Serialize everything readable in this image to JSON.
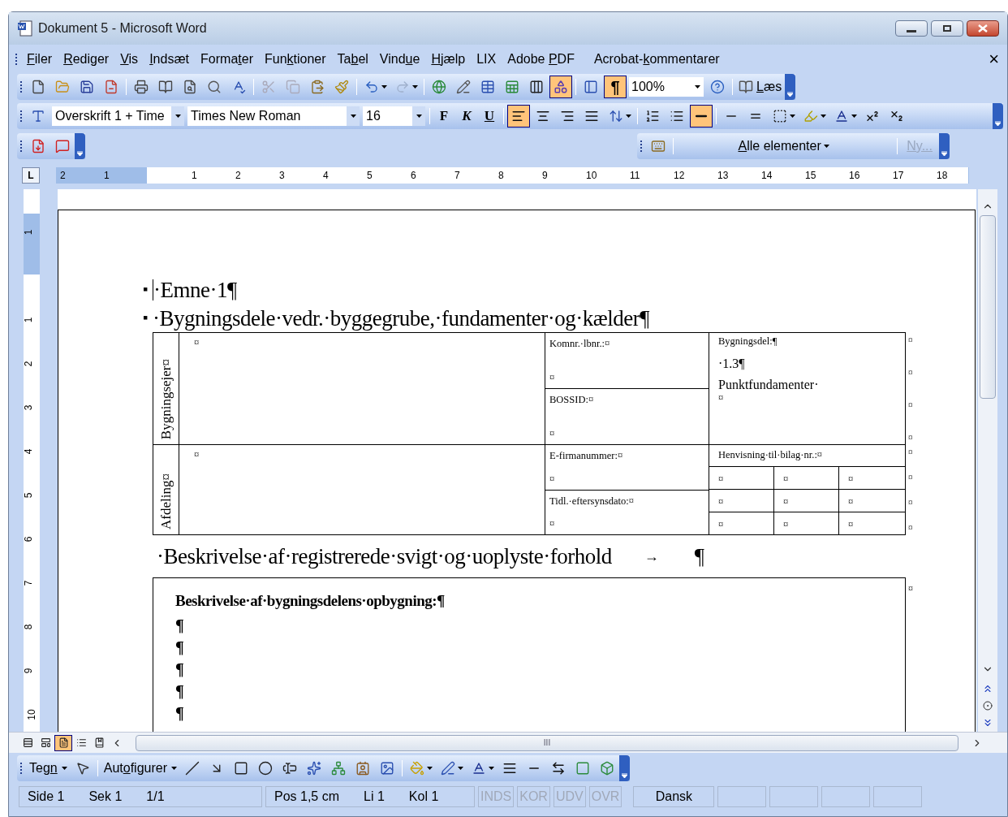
{
  "window": {
    "title": "Dokument 5 - Microsoft Word"
  },
  "menu": [
    {
      "key": "F",
      "post": "iler"
    },
    {
      "key": "R",
      "post": "ediger"
    },
    {
      "key": "V",
      "post": "is"
    },
    {
      "key": "I",
      "post": "ndsæt"
    },
    {
      "pre": "Forma",
      "key": "t",
      "post": "er"
    },
    {
      "pre": "Fun",
      "key": "k",
      "post": "tioner"
    },
    {
      "pre": "Ta",
      "key": "b",
      "post": "el"
    },
    {
      "pre": "Vind",
      "key": "u",
      "post": "e"
    },
    {
      "key": "H",
      "post": "jælp"
    },
    {
      "pre": "LIX"
    },
    {
      "pre": "Adobe ",
      "key": "P",
      "post": "DF"
    },
    {
      "pre": "Acrobat-",
      "key": "k",
      "post": "ommentarer"
    }
  ],
  "close_document": "×",
  "standard_toolbar": {
    "drawing_pressed": true,
    "show_formatting": {
      "label": "¶",
      "pressed": true
    },
    "zoom": "100%",
    "read": {
      "key": "L",
      "post": "æs"
    }
  },
  "formatting_toolbar": {
    "style": "Overskrift 1 + Time",
    "font": "Times New Roman",
    "size": "16",
    "bold": "F",
    "italic": "K",
    "underline": "U",
    "alignment": [
      {
        "selected": true
      },
      {
        "selected": false
      },
      {
        "selected": false
      },
      {
        "selected": false
      }
    ],
    "border_pressed": true
  },
  "reviewing_toolbar": {
    "show": {
      "key": "A",
      "post": "lle elementer"
    },
    "new_comment": {
      "label": "Ny...",
      "disabled": true
    }
  },
  "ruler": {
    "tab_type": "L",
    "labels": [
      "2",
      "1",
      "1",
      "2",
      "3",
      "4",
      "5",
      "6",
      "7",
      "8",
      "9",
      "10",
      "11",
      "12",
      "13",
      "14",
      "15",
      "16",
      "17",
      "18"
    ]
  },
  "vertical_ruler": {
    "labels": [
      "1",
      "1",
      "2",
      "3",
      "4",
      "5",
      "6",
      "7",
      "8",
      "9",
      "10"
    ]
  },
  "document": {
    "headings": [
      {
        "bullet": "▪",
        "text": "·Emne·1¶",
        "cursor": true
      },
      {
        "bullet": "▪",
        "text": "·Bygningsdele·vedr.·byggegrube,·fundamenter·og·kælder¶",
        "cursor": false
      }
    ],
    "table": {
      "rows": [
        {
          "kind": "part",
          "side_label": "Bygningsejer¤",
          "main": "¤",
          "info": [
            {
              "label": "Komnr.·lbnr.:¤",
              "value": "¤"
            },
            {
              "label": "BOSSID:¤",
              "value": "¤"
            }
          ],
          "part_lines": [
            "Bygningsdel:¶",
            "·1.3¶",
            "Punktfundamenter·",
            "¤"
          ],
          "end_marks": [
            "¤",
            "¤",
            "¤",
            "¤"
          ]
        },
        {
          "kind": "reference",
          "side_label": "Afdeling¤",
          "main": "¤",
          "info": [
            {
              "label": "E-firmanummer:¤",
              "value": "¤"
            },
            {
              "label": "Tidl.·eftersynsdato:¤",
              "value": "¤"
            }
          ],
          "reference_label": "Henvisning·til·bilag·nr.:¤",
          "grid": [
            [
              "¤",
              "¤",
              "¤"
            ],
            [
              "¤",
              "¤",
              "¤"
            ],
            [
              "¤",
              "¤",
              "¤"
            ]
          ],
          "end_marks": [
            "¤",
            "¤",
            "¤",
            "¤"
          ]
        }
      ]
    },
    "heading3": {
      "text": "·Beskrivelse·af·registrerede·svigt·og·uoplyste·forhold",
      "tab": "→",
      "mark": "¶"
    },
    "description_box": {
      "title": "Beskrivelse·af·bygningsdelens·opbygning:¶",
      "lines": [
        "¶",
        "¶",
        "¶",
        "¶",
        "¶"
      ],
      "end_mark": "¤"
    }
  },
  "view_buttons": [
    {
      "selected": false
    },
    {
      "selected": false
    },
    {
      "selected": true
    },
    {
      "selected": false
    },
    {
      "selected": false
    }
  ],
  "scrollbar_grip": "III",
  "drawing_toolbar": {
    "draw": {
      "pre": "Teg",
      "key": "n"
    },
    "autoshapes": {
      "pre": "Aut",
      "key": "o",
      "post": "figurer"
    }
  },
  "status_bar": {
    "groups": [
      [
        "Side 1",
        "Sek 1",
        "1/1"
      ],
      [
        "Pos 1,5 cm",
        "Li 1",
        "Kol 1"
      ]
    ],
    "modes": [
      {
        "label": "INDS",
        "active": false
      },
      {
        "label": "KOR",
        "active": false
      },
      {
        "label": "UDV",
        "active": false
      },
      {
        "label": "OVR",
        "active": false
      }
    ],
    "language": "Dansk"
  }
}
